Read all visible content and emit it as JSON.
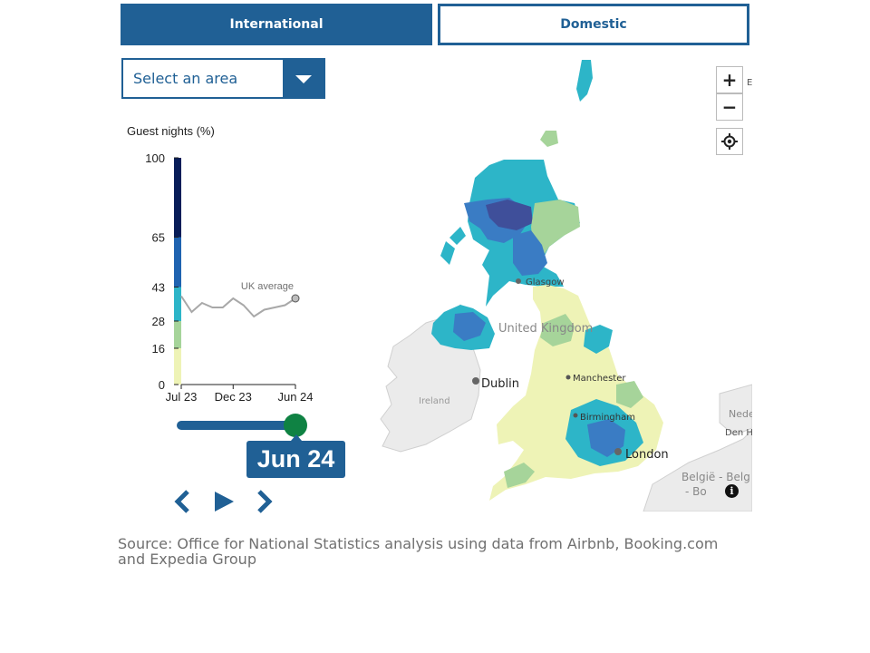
{
  "tabs": [
    {
      "label": "International",
      "active": true
    },
    {
      "label": "Domestic",
      "active": false
    }
  ],
  "area_select": {
    "value": "Select an area"
  },
  "chart_data": {
    "type": "line",
    "ylabel": "Guest nights (%)",
    "y_ticks": [
      "100",
      "65",
      "43",
      "28",
      "16",
      "0"
    ],
    "x_ticks": [
      "Jul 23",
      "Dec 23",
      "Jun 24"
    ],
    "legend_breaks": [
      0,
      16,
      28,
      43,
      65,
      100
    ],
    "legend_colors": [
      "#eef3b6",
      "#a6d49a",
      "#2db5c8",
      "#1f63b0",
      "#081d58"
    ],
    "series": [
      {
        "name": "UK average",
        "x": [
          "Jul 23",
          "Aug 23",
          "Sep 23",
          "Oct 23",
          "Nov 23",
          "Dec 23",
          "Jan 24",
          "Feb 24",
          "Mar 24",
          "Apr 24",
          "May 24",
          "Jun 24"
        ],
        "values": [
          39,
          32,
          36,
          34,
          34,
          38,
          35,
          30,
          33,
          34,
          35,
          38
        ]
      }
    ],
    "ylim": [
      0,
      100
    ]
  },
  "timeline": {
    "current_label": "Jun 24",
    "position": 1.0
  },
  "map": {
    "labels": {
      "uk": "United Kingdom",
      "glasgow": "Glasgow",
      "manchester": "Manchester",
      "birmingham": "Birmingham",
      "london": "London",
      "dublin": "Dublin",
      "ireland": "Ireland",
      "belgie": "België - Belg",
      "belgie2": "- Bo",
      "neder": "Nede",
      "denha": "Den Ha",
      "corner": "E"
    },
    "controls": {
      "zoom_in": "+",
      "zoom_out": "−"
    }
  },
  "colors": {
    "primary": "#206095",
    "knob": "#0f8243"
  },
  "source_text": "Source: Office for National Statistics analysis using data from Airbnb, Booking.com and Expedia Group"
}
